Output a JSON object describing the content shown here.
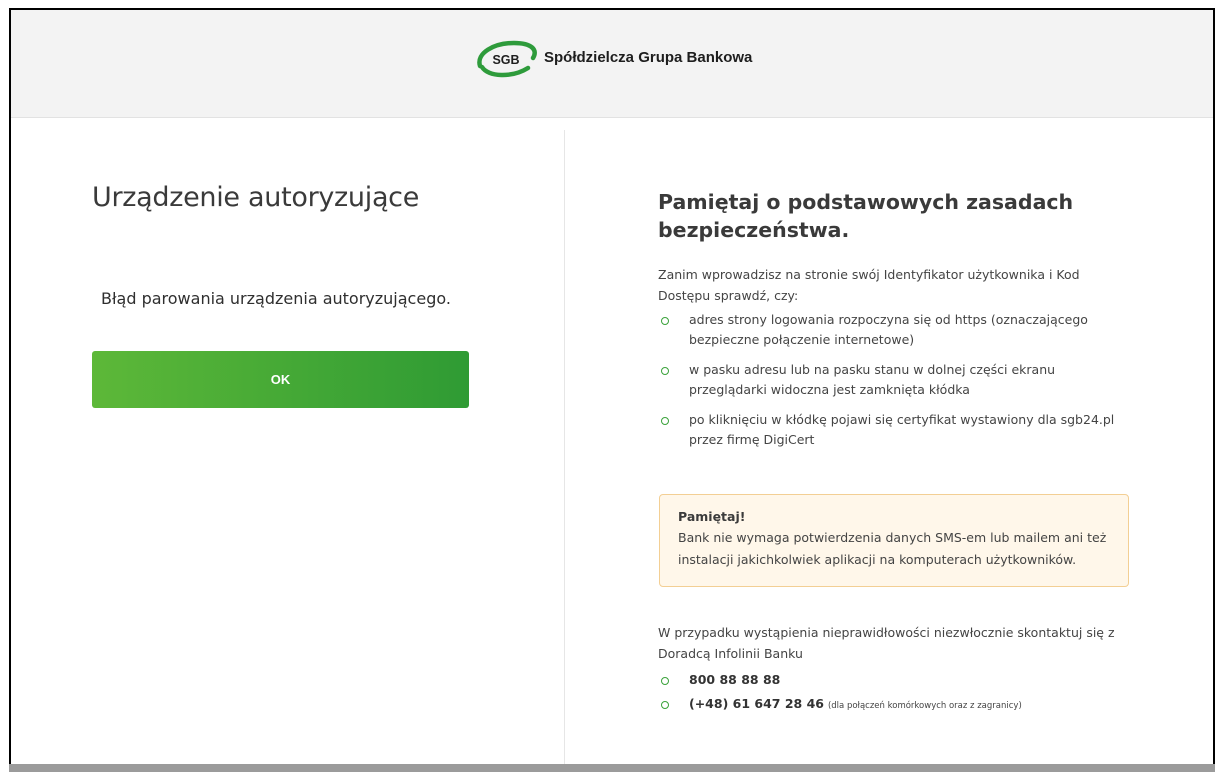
{
  "header": {
    "logo_abbr": "SGB",
    "brand_name": "Spółdzielcza Grupa Bankowa",
    "logo_color": "#2e9b3b"
  },
  "left": {
    "title": "Urządzenie autoryzujące",
    "error_message": "Błąd parowania urządzenia autoryzującego.",
    "ok_button": "OK"
  },
  "right": {
    "title": "Pamiętaj o podstawowych zasadach bezpieczeństwa.",
    "intro": "Zanim wprowadzisz na stronie swój Identyfikator użytkownika i Kod Dostępu sprawdź, czy:",
    "checks": [
      "adres strony logowania rozpoczyna się od https (oznaczającego bezpieczne połączenie internetowe)",
      "w pasku adresu lub na pasku stanu w dolnej części ekranu przeglądarki widoczna jest zamknięta kłódka",
      "po kliknięciu w kłódkę pojawi się certyfikat wystawiony dla sgb24.pl przez firmę DigiCert"
    ],
    "notice": {
      "title": "Pamiętaj!",
      "body": "Bank nie wymaga potwierdzenia danych SMS-em lub mailem ani też instalacji jakichkolwiek aplikacji na komputerach użytkowników."
    },
    "contact": {
      "text": "W przypadku wystąpienia nieprawidłowości niezwłocznie skontaktuj się z Doradcą Infolinii Banku",
      "phones": [
        {
          "number": "800 88 88 88",
          "note": ""
        },
        {
          "number": "(+48) 61 647 28 46",
          "note": "(dla połączeń komórkowych oraz z zagranicy)"
        }
      ]
    }
  },
  "colors": {
    "accent_green": "#3aa23a",
    "button_gradient_start": "#5db838",
    "button_gradient_end": "#2f9b34",
    "notice_bg": "#fff7ea",
    "notice_border": "#f3cf94"
  }
}
